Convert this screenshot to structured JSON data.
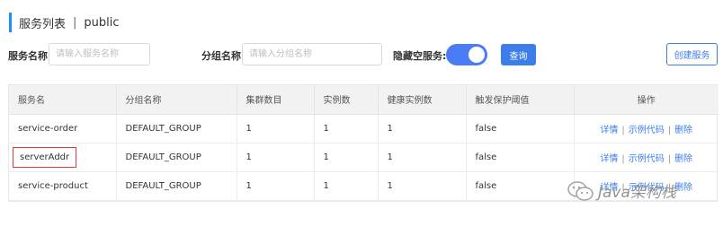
{
  "header": {
    "title": "服务列表",
    "separator": "|",
    "namespace": "public"
  },
  "filters": {
    "service_name_label": "服务名称",
    "service_name_placeholder": "请输入服务名称",
    "group_name_label": "分组名称",
    "group_name_placeholder": "请输入分组名称",
    "hide_empty_label": "隐藏空服务:",
    "hide_empty_on": true,
    "query_button": "查询",
    "create_button": "创建服务"
  },
  "table": {
    "columns": [
      "服务名",
      "分组名称",
      "集群数目",
      "实例数",
      "健康实例数",
      "触发保护阈值",
      "操作"
    ],
    "rows": [
      {
        "service": "service-order",
        "group": "DEFAULT_GROUP",
        "clusters": "1",
        "instances": "1",
        "healthy": "1",
        "threshold": "false"
      },
      {
        "service": "serverAddr",
        "group": "DEFAULT_GROUP",
        "clusters": "1",
        "instances": "1",
        "healthy": "1",
        "threshold": "false"
      },
      {
        "service": "service-product",
        "group": "DEFAULT_GROUP",
        "clusters": "1",
        "instances": "1",
        "healthy": "1",
        "threshold": "false"
      }
    ],
    "actions": {
      "detail": "详情",
      "sample_code": "示例代码",
      "delete": "删除",
      "separator": "|"
    }
  },
  "watermark": {
    "text": "Java架构栈",
    "icon": "wechat-icon"
  },
  "colors": {
    "accent": "#3d7de9",
    "toggle": "#4a7cf6",
    "highlight_border": "#e53935"
  }
}
